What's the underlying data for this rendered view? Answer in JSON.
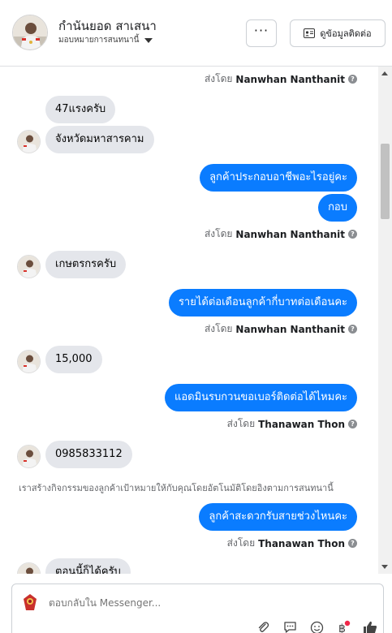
{
  "header": {
    "name": "กำนันยอด สาเสนา",
    "assign_label": "มอบหมายการสนทนานี้",
    "more_label": "···",
    "contact_label": "ดูข้อมูลติดต่อ"
  },
  "messages": {
    "sent_prefix": "ส่งโดย",
    "help_glyph": "?",
    "sender_1": "Nanwhan Nanthanit",
    "in_1": "47แรงครับ",
    "in_2": "จังหวัดมหาสารคาม",
    "out_1": "ลูกค้าประกอบอาชีพอะไรอยู่คะ",
    "out_2": "กอบ",
    "sender_2": "Nanwhan Nanthanit",
    "in_3": "เกษตรกรครับ",
    "out_3": "รายได้ต่อเดือนลูกค้ากี่บาทต่อเดือนคะ",
    "sender_3": "Nanwhan Nanthanit",
    "in_4": "15,000",
    "out_4": "แอดมินรบกวนขอเบอร์ติดต่อได้ไหมคะ",
    "sender_4": "Thanawan Thon",
    "in_5": "0985833112",
    "system_note": "เราสร้างกิจกรรมของลูกค้าเป้าหมายให้กับคุณโดยอัตโนมัติโดยอิงตามการสนทนานี้",
    "out_5": "ลูกค้าสะดวกรับสายช่วงไหนคะ",
    "sender_5": "Thanawan Thon",
    "in_6_partial": "ตอนนี้ก็ได้ครับ"
  },
  "composer": {
    "placeholder": "ตอบกลับใน Messenger..."
  },
  "icons": {
    "more": "ellipsis-icon",
    "contact": "contact-card-icon",
    "attach": "paperclip-icon",
    "saved_reply": "chat-bubble-icon",
    "emoji": "emoji-icon",
    "payment": "baht-icon",
    "like": "thumbs-up-icon"
  },
  "colors": {
    "outgoing_bubble": "#0a7cff",
    "incoming_bubble": "#e4e6eb",
    "badge": "#f02849"
  }
}
